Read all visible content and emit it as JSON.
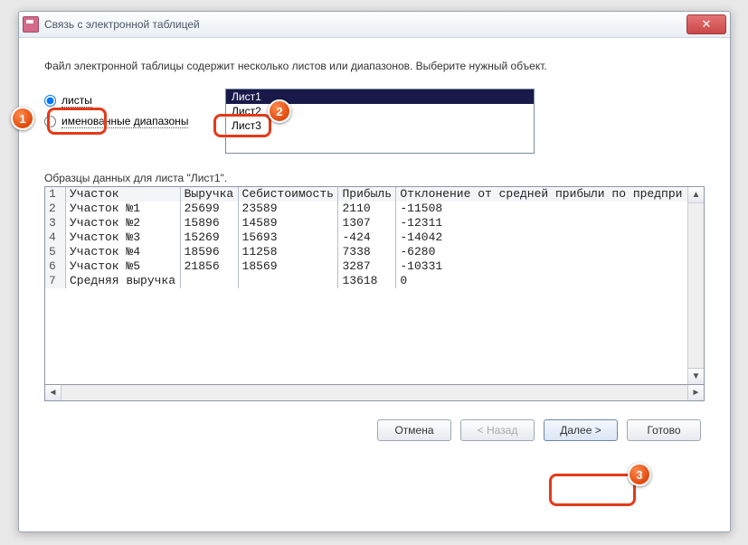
{
  "window": {
    "title": "Связь с электронной таблицей"
  },
  "intro": "Файл электронной таблицы содержит несколько листов или диапазонов.  Выберите нужный объект.",
  "radios": {
    "sheets": "листы",
    "named_ranges": "именованные диапазоны"
  },
  "sheets": {
    "items": [
      "Лист1",
      "Лист2",
      "Лист3"
    ],
    "selected": "Лист1"
  },
  "sample_label": "Образцы данных для листа \"Лист1\".",
  "table": {
    "headers": [
      "Участок",
      "Выручка",
      "Себистоимость",
      "Прибыль",
      "Отклонение от средней прибыли по предпри"
    ],
    "rows": [
      [
        "Участок №1",
        "25699",
        "23589",
        "2110",
        "-11508"
      ],
      [
        "Участок №2",
        "15896",
        "14589",
        "1307",
        "-12311"
      ],
      [
        "Участок №3",
        "15269",
        "15693",
        "-424",
        "-14042"
      ],
      [
        "Участок №4",
        "18596",
        "11258",
        "7338",
        "-6280"
      ],
      [
        "Участок №5",
        "21856",
        "18569",
        "3287",
        "-10331"
      ],
      [
        "Средняя выручка",
        "",
        "",
        "13618",
        "0"
      ]
    ]
  },
  "buttons": {
    "cancel": "Отмена",
    "back": "< Назад",
    "next": "Далее >",
    "finish": "Готово"
  },
  "callouts": {
    "c1": "1",
    "c2": "2",
    "c3": "3"
  }
}
